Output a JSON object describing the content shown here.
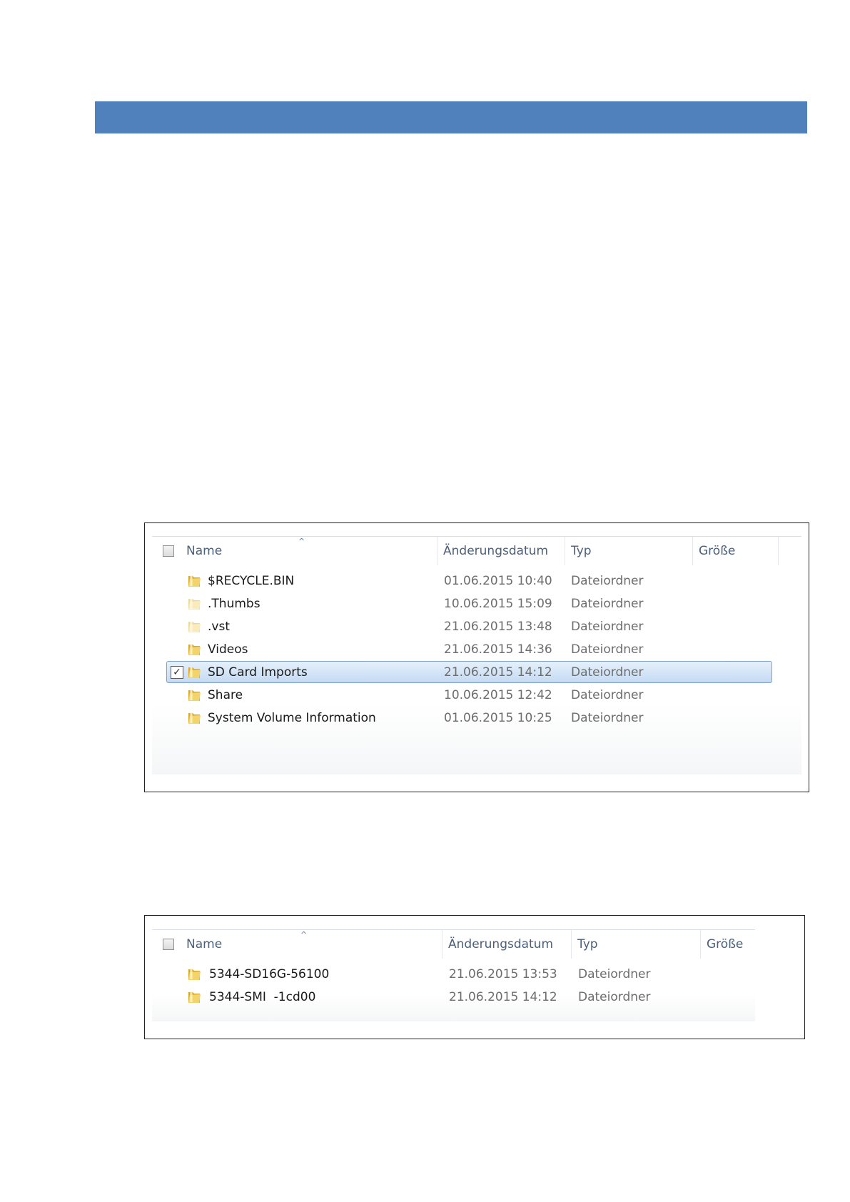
{
  "colors": {
    "header_bar": "#5181bd",
    "selection": "#c4daf3",
    "folder": "#e8c04a"
  },
  "explorer1": {
    "columns": {
      "name": "Name",
      "date": "Änderungsdatum",
      "type": "Typ",
      "size": "Größe"
    },
    "sort_indicator": "^",
    "rows": [
      {
        "name": "$RECYCLE.BIN",
        "date": "01.06.2015 10:40",
        "type": "Dateiordner",
        "icon": "folder-icon",
        "faded": false,
        "selected": false
      },
      {
        "name": ".Thumbs",
        "date": "10.06.2015 15:09",
        "type": "Dateiordner",
        "icon": "folder-icon",
        "faded": true,
        "selected": false
      },
      {
        "name": ".vst",
        "date": "21.06.2015 13:48",
        "type": "Dateiordner",
        "icon": "folder-icon",
        "faded": true,
        "selected": false
      },
      {
        "name": "Videos",
        "date": "21.06.2015 14:36",
        "type": "Dateiordner",
        "icon": "folder-icon",
        "faded": false,
        "selected": false
      },
      {
        "name": "SD Card Imports",
        "date": "21.06.2015 14:12",
        "type": "Dateiordner",
        "icon": "folder-icon",
        "faded": false,
        "selected": true,
        "check": "✓"
      },
      {
        "name": "Share",
        "date": "10.06.2015 12:42",
        "type": "Dateiordner",
        "icon": "folder-icon",
        "faded": false,
        "selected": false
      },
      {
        "name": "System Volume Information",
        "date": "01.06.2015 10:25",
        "type": "Dateiordner",
        "icon": "folder-icon",
        "faded": false,
        "selected": false
      }
    ]
  },
  "explorer2": {
    "columns": {
      "name": "Name",
      "date": "Änderungsdatum",
      "type": "Typ",
      "size": "Größe"
    },
    "sort_indicator": "^",
    "rows": [
      {
        "name": "5344-SD16G-56100",
        "date": "21.06.2015 13:53",
        "type": "Dateiordner",
        "icon": "folder-icon"
      },
      {
        "name": "5344-SMI  -1cd00",
        "date": "21.06.2015 14:12",
        "type": "Dateiordner",
        "icon": "folder-icon"
      }
    ]
  }
}
